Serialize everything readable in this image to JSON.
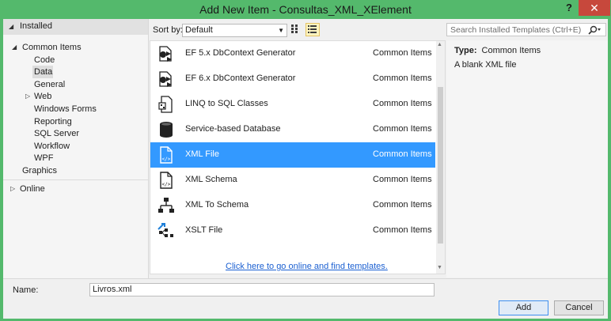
{
  "window": {
    "title": "Add New Item - Consultas_XML_XElement",
    "help": "?",
    "close": "✕"
  },
  "tree": {
    "installed": "Installed",
    "items": [
      {
        "label": "Common Items",
        "name": "common-items"
      },
      {
        "label": "Code",
        "name": "code"
      },
      {
        "label": "Data",
        "name": "data"
      },
      {
        "label": "General",
        "name": "general"
      },
      {
        "label": "Web",
        "name": "web"
      },
      {
        "label": "Windows Forms",
        "name": "windows-forms"
      },
      {
        "label": "Reporting",
        "name": "reporting"
      },
      {
        "label": "SQL Server",
        "name": "sql-server"
      },
      {
        "label": "Workflow",
        "name": "workflow"
      },
      {
        "label": "WPF",
        "name": "wpf"
      },
      {
        "label": "Graphics",
        "name": "graphics"
      }
    ],
    "online": "Online"
  },
  "toolbar": {
    "sort_label": "Sort by:",
    "sort_value": "Default",
    "search_placeholder": "Search Installed Templates (Ctrl+E)"
  },
  "templates": [
    {
      "name": "EF 5.x DbContext Generator",
      "category": "Common Items",
      "icon": "ef-generator-icon"
    },
    {
      "name": "EF 6.x DbContext Generator",
      "category": "Common Items",
      "icon": "ef-generator-icon"
    },
    {
      "name": "LINQ to SQL Classes",
      "category": "Common Items",
      "icon": "linq-classes-icon"
    },
    {
      "name": "Service-based Database",
      "category": "Common Items",
      "icon": "database-icon"
    },
    {
      "name": "XML File",
      "category": "Common Items",
      "icon": "xml-file-icon",
      "selected": true
    },
    {
      "name": "XML Schema",
      "category": "Common Items",
      "icon": "xml-schema-icon"
    },
    {
      "name": "XML To Schema",
      "category": "Common Items",
      "icon": "xml-to-schema-icon"
    },
    {
      "name": "XSLT File",
      "category": "Common Items",
      "icon": "xslt-file-icon"
    }
  ],
  "online_link": "Click here to go online and find templates.",
  "details": {
    "type_label": "Type:",
    "type_value": "Common Items",
    "description": "A blank XML file"
  },
  "footer": {
    "name_label": "Name:",
    "name_value": "Livros.xml",
    "add_label": "Add",
    "cancel_label": "Cancel"
  },
  "colors": {
    "accent": "#54b96c",
    "selection": "#3399ff",
    "close": "#c7483c"
  }
}
